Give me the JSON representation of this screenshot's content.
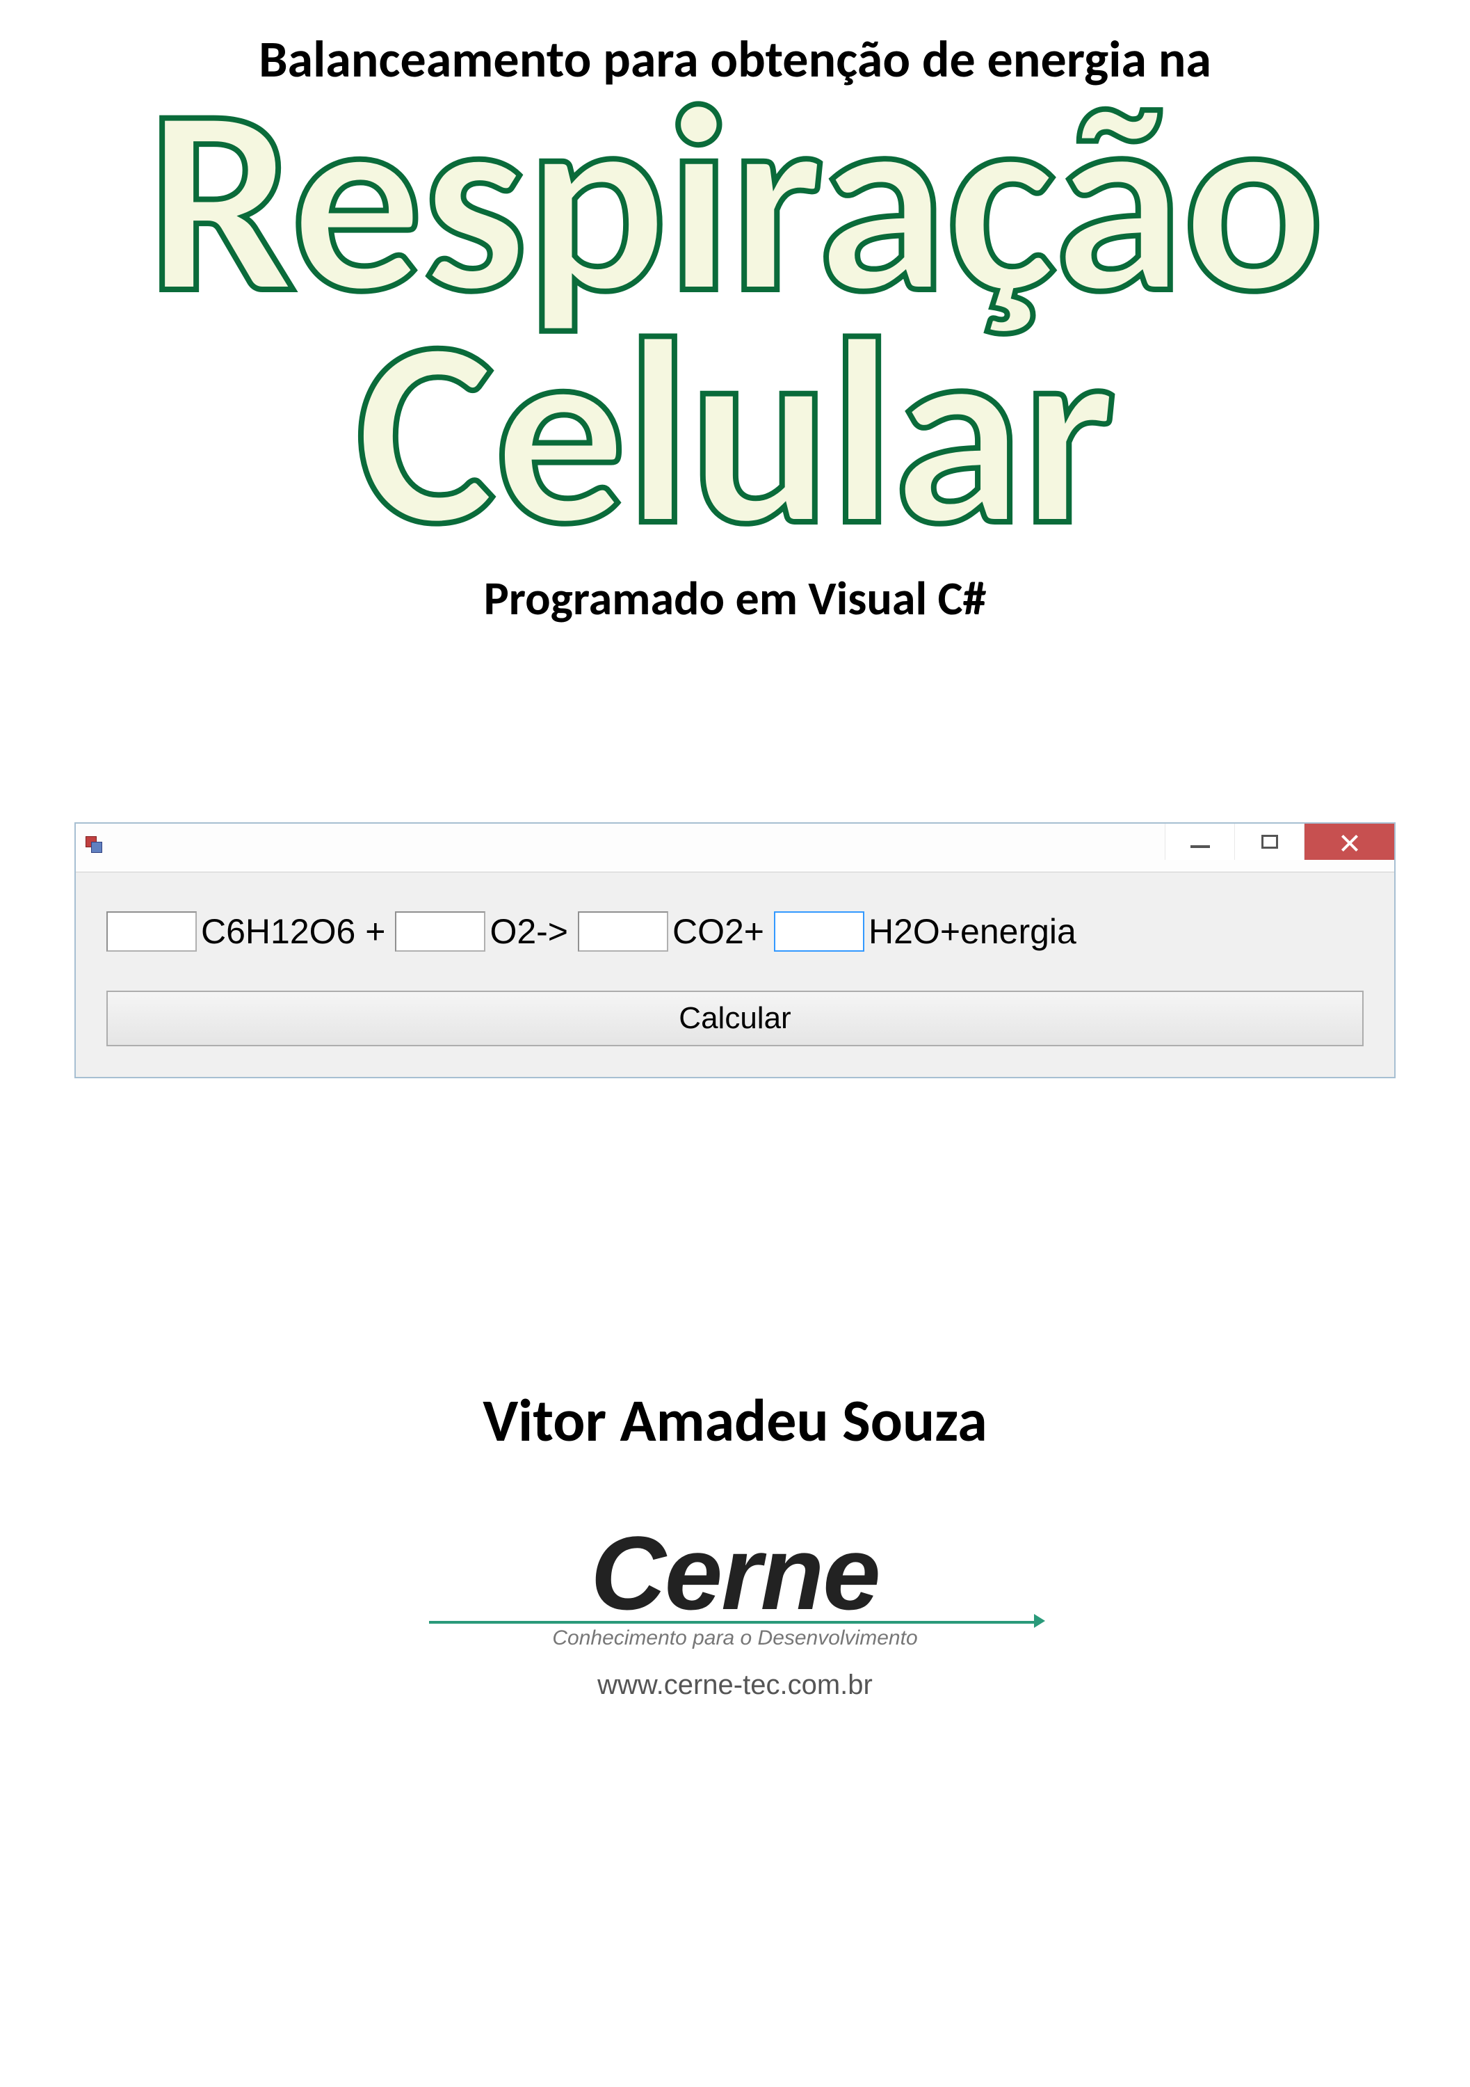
{
  "header": {
    "supertitle": "Balanceamento para obtenção de energia na",
    "title_line1": "Respiração",
    "title_line2": "Celular",
    "subtitle": "Programado em Visual C#"
  },
  "form": {
    "equation": {
      "coef1_value": "",
      "term1": "C6H12O6 +",
      "coef2_value": "",
      "term2": "O2->",
      "coef3_value": "",
      "term3": "CO2+",
      "coef4_value": "",
      "term4": "H2O+energia"
    },
    "button_label": "Calcular"
  },
  "author": "Vitor Amadeu Souza",
  "publisher": {
    "name": "Cerne",
    "tagline": "Conhecimento para o Desenvolvimento",
    "url": "www.cerne-tec.com.br"
  }
}
